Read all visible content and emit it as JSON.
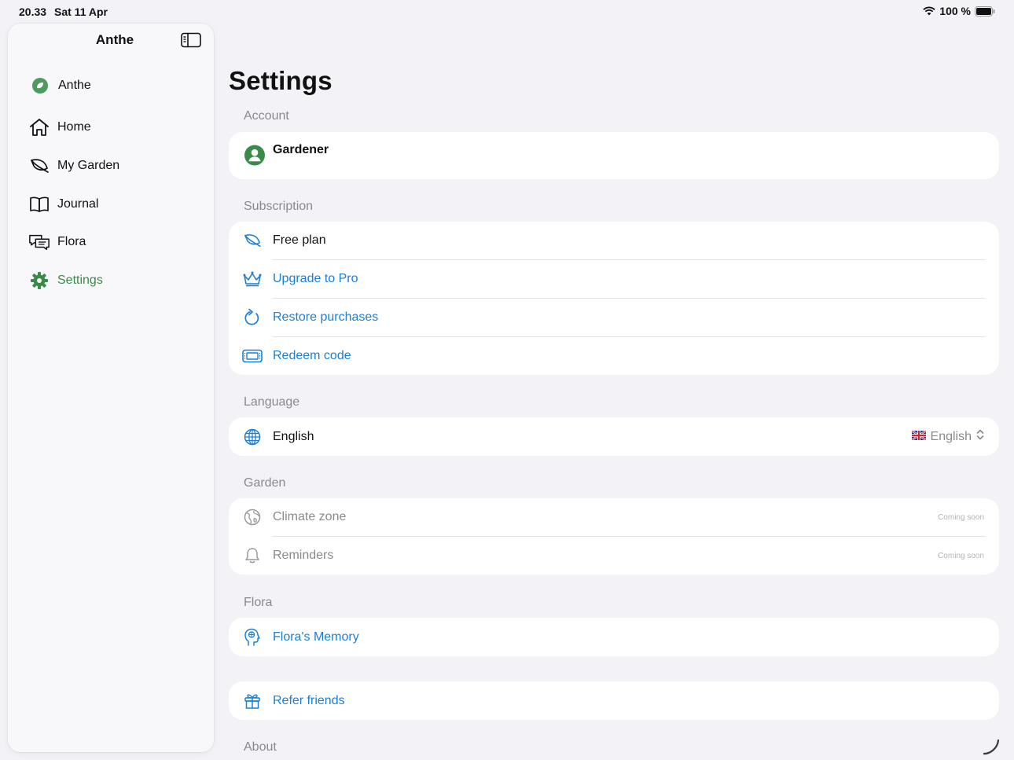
{
  "status_bar": {
    "time": "20.33",
    "date": "Sat 11 Apr",
    "battery": "100 %"
  },
  "sidebar": {
    "title": "Anthe",
    "items": [
      {
        "label": "Anthe",
        "icon": "leaf-badge-icon"
      },
      {
        "label": "Home",
        "icon": "house-icon"
      },
      {
        "label": "My Garden",
        "icon": "leaf-icon"
      },
      {
        "label": "Journal",
        "icon": "book-icon"
      },
      {
        "label": "Flora",
        "icon": "chat-bubbles-icon"
      },
      {
        "label": "Settings",
        "icon": "gear-icon",
        "active": true
      }
    ]
  },
  "page": {
    "title": "Settings"
  },
  "sections": {
    "account": {
      "header": "Account",
      "user": "Gardener"
    },
    "subscription": {
      "header": "Subscription",
      "free_plan": "Free plan",
      "upgrade": "Upgrade to Pro",
      "restore": "Restore purchases",
      "redeem": "Redeem code"
    },
    "language": {
      "header": "Language",
      "label": "English",
      "value": "English"
    },
    "garden": {
      "header": "Garden",
      "climate": "Climate zone",
      "reminders": "Reminders",
      "coming_soon": "Coming soon"
    },
    "flora": {
      "header": "Flora",
      "memory": "Flora's Memory"
    },
    "refer": {
      "label": "Refer friends"
    },
    "about": {
      "header": "About"
    }
  },
  "colors": {
    "accent_green": "#3a8a4a",
    "link_blue": "#1a7fd6",
    "background": "#f2f2f7"
  }
}
